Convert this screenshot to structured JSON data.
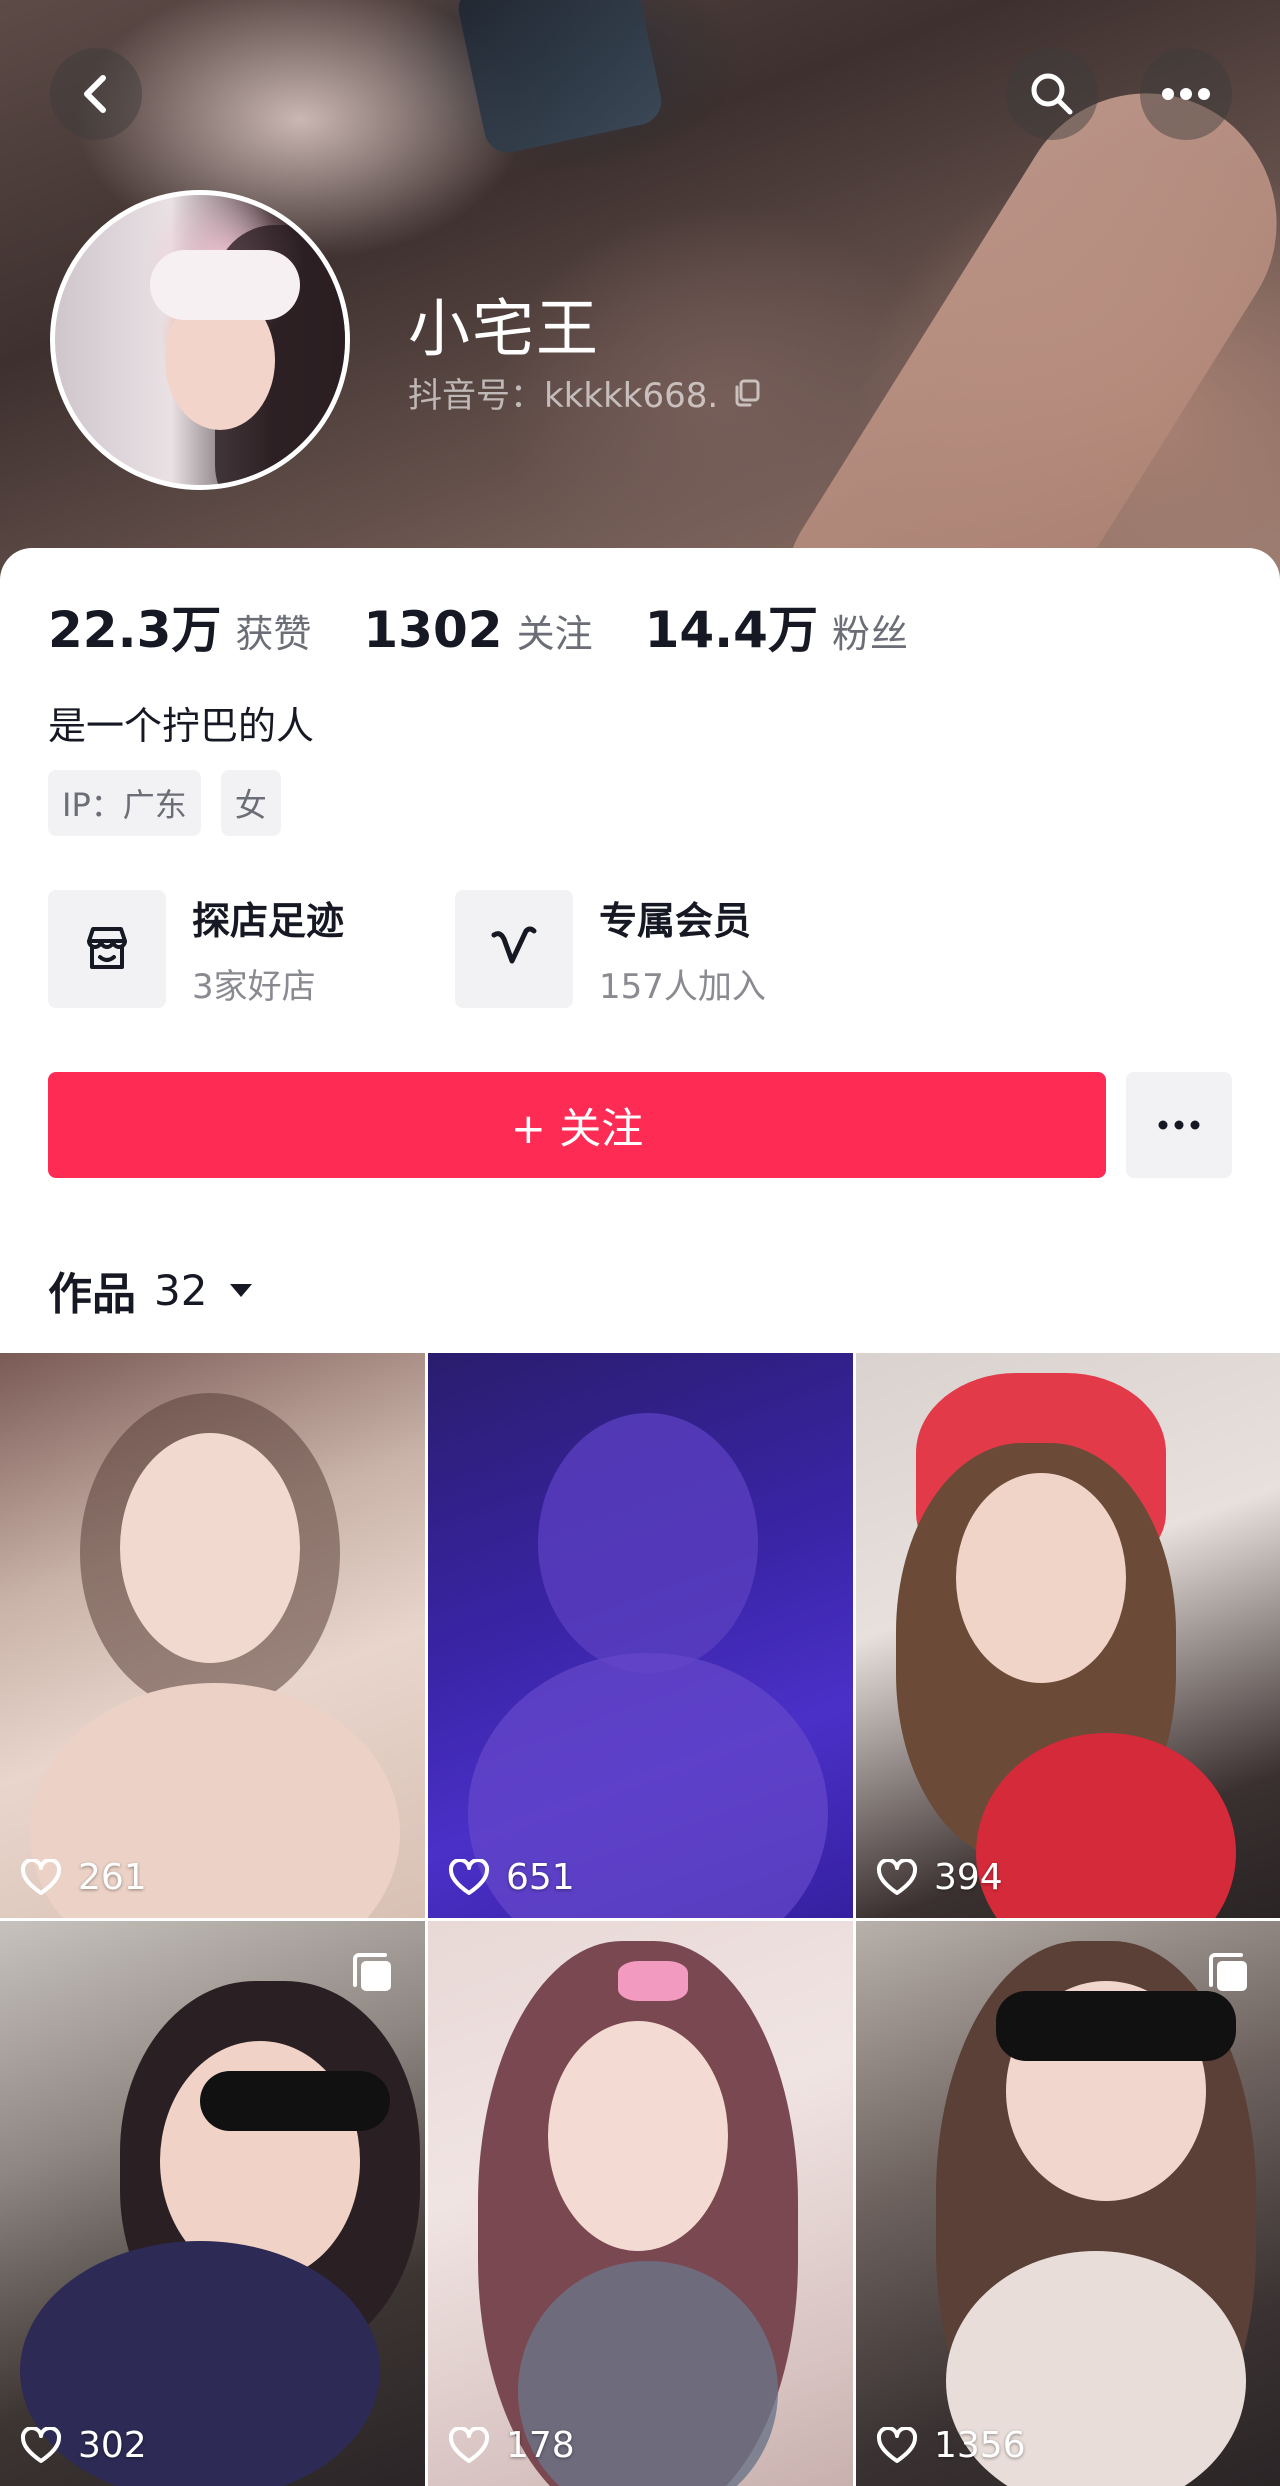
{
  "header": {
    "name": "小宅王",
    "douyin_id": "抖音号：kkkkk668."
  },
  "stats": [
    {
      "value": "22.3万",
      "label": "获赞"
    },
    {
      "value": "1302",
      "label": "关注"
    },
    {
      "value": "14.4万",
      "label": "粉丝"
    }
  ],
  "bio": "是一个拧巴的人",
  "tags": [
    "IP：广东",
    "女"
  ],
  "features": [
    {
      "title": "探店足迹",
      "subtitle": "3家好店",
      "icon": "store-icon"
    },
    {
      "title": "专属会员",
      "subtitle": "157人加入",
      "icon": "membership-v-icon"
    }
  ],
  "actions": {
    "follow_label": "+ 关注",
    "more_icon": "ellipsis-icon"
  },
  "works": {
    "label": "作品",
    "count": "32"
  },
  "videos": [
    {
      "likes": "261",
      "multi": false
    },
    {
      "likes": "651",
      "multi": false
    },
    {
      "likes": "394",
      "multi": false
    },
    {
      "likes": "302",
      "multi": true
    },
    {
      "likes": "178",
      "multi": false
    },
    {
      "likes": "1356",
      "multi": true
    }
  ],
  "colors": {
    "accent": "#fe2c55",
    "text_primary": "#161823",
    "text_secondary": "#6b6e76",
    "chip_bg": "#f2f2f4"
  }
}
